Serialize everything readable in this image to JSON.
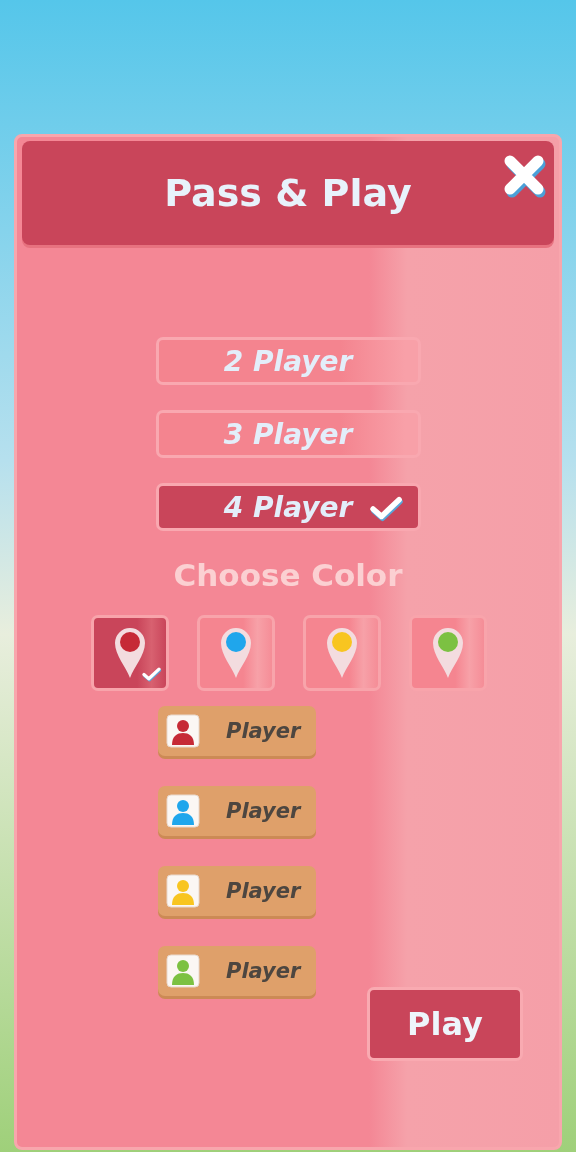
{
  "dialog": {
    "title": "Pass & Play"
  },
  "player_counts": [
    {
      "label": "2 Player",
      "selected": false
    },
    {
      "label": "3 Player",
      "selected": false
    },
    {
      "label": "4 Player",
      "selected": true
    }
  ],
  "color_heading": "Choose Color",
  "colors": [
    {
      "color": "#c62a36",
      "selected": true
    },
    {
      "color": "#1fa6ec",
      "selected": false
    },
    {
      "color": "#f8c520",
      "selected": false
    },
    {
      "color": "#7cc142",
      "selected": false
    }
  ],
  "players": [
    {
      "name": "Player",
      "color": "#c62a36"
    },
    {
      "name": "Player",
      "color": "#1fa6ec"
    },
    {
      "name": "Player",
      "color": "#f8c520"
    },
    {
      "name": "Player",
      "color": "#7cc142"
    }
  ],
  "play_button": "Play"
}
